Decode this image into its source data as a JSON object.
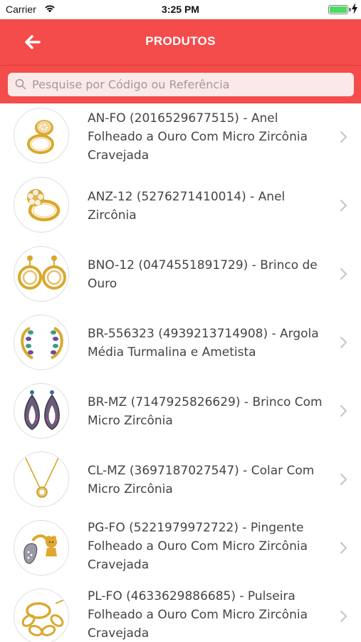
{
  "status_bar": {
    "carrier": "Carrier",
    "time": "3:25 PM"
  },
  "nav": {
    "title": "PRODUTOS"
  },
  "search": {
    "placeholder": "Pesquise por Código ou Referência"
  },
  "colors": {
    "brand_red": "#f44b4b",
    "gold": "#d9a82e",
    "text": "#444444"
  },
  "products": [
    {
      "label": "AN-FO (2016529677515) - Anel Folheado a Ouro Com Micro Zircônia Cravejada",
      "thumb": "ring-icon"
    },
    {
      "label": "ANZ-12 (5276271410014) - Anel Zircônia",
      "thumb": "ring-flower-icon"
    },
    {
      "label": "BNO-12 (0474551891729) - Brinco de Ouro",
      "thumb": "earring-hoop-icon"
    },
    {
      "label": "BR-556323 (4939213714908) - Argola Média Turmalina e Ametista",
      "thumb": "argola-icon"
    },
    {
      "label": "BR-MZ (7147925826629) - Brinco Com Micro Zircônia",
      "thumb": "earring-drop-icon"
    },
    {
      "label": "CL-MZ (3697187027547) - Colar Com Micro Zircônia",
      "thumb": "necklace-icon"
    },
    {
      "label": "PG-FO (5221979972722) - Pingente Folheado a Ouro Com Micro Zircônia Cravejada",
      "thumb": "pendant-icon"
    },
    {
      "label": "PL-FO (4633629886685) - Pulseira Folheado a Ouro Com Micro Zircônia Cravejada",
      "thumb": "bracelet-icon"
    }
  ]
}
